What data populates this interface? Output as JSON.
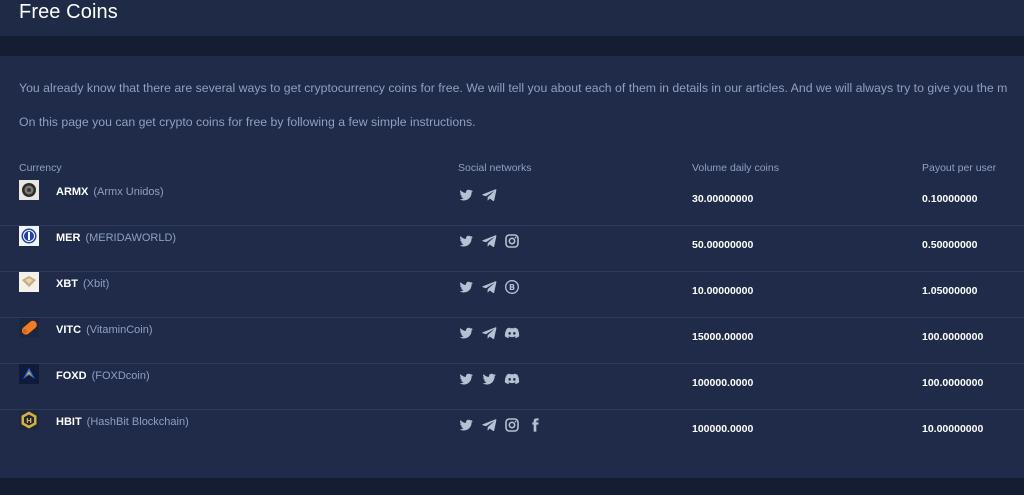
{
  "page": {
    "title": "Free Coins"
  },
  "intro": {
    "paragraph1": "You already know that there are several ways to get cryptocurrency coins for free. We will tell you about each of them in details in our articles. And we will always try to give you the m",
    "paragraph2": "On this page you can get crypto coins for free by following a few simple instructions."
  },
  "table": {
    "headers": {
      "currency": "Currency",
      "social": "Social networks",
      "volume": "Volume daily coins",
      "payout": "Payout per user"
    },
    "rows": [
      {
        "symbol": "ARMX",
        "name": "(Armx Unidos)",
        "logo": "armx-logo",
        "socials": [
          "twitter-icon",
          "telegram-icon"
        ],
        "volume": "30.00000000",
        "payout": "0.10000000"
      },
      {
        "symbol": "MER",
        "name": "(MERIDAWORLD)",
        "logo": "mer-logo",
        "socials": [
          "twitter-icon",
          "telegram-icon",
          "instagram-icon"
        ],
        "volume": "50.00000000",
        "payout": "0.50000000"
      },
      {
        "symbol": "XBT",
        "name": "(Xbit)",
        "logo": "xbt-logo",
        "socials": [
          "twitter-icon",
          "telegram-icon",
          "bitcointalk-icon"
        ],
        "volume": "10.00000000",
        "payout": "1.05000000"
      },
      {
        "symbol": "VITC",
        "name": "(VitaminCoin)",
        "logo": "vitc-logo",
        "socials": [
          "twitter-icon",
          "telegram-icon",
          "discord-icon"
        ],
        "volume": "15000.00000",
        "payout": "100.0000000"
      },
      {
        "symbol": "FOXD",
        "name": "(FOXDcoin)",
        "logo": "foxd-logo",
        "socials": [
          "twitter-icon",
          "twitter-icon",
          "discord-icon"
        ],
        "volume": "100000.0000",
        "payout": "100.0000000"
      },
      {
        "symbol": "HBIT",
        "name": "(HashBit Blockchain)",
        "logo": "hbit-logo",
        "socials": [
          "twitter-icon",
          "telegram-icon",
          "instagram-icon",
          "facebook-icon"
        ],
        "volume": "100000.0000",
        "payout": "10.00000000"
      }
    ]
  },
  "colors": {
    "background": "#1f2b48",
    "band": "#141d32",
    "muted_text": "#8fa0c4",
    "icon": "#b7c0d3"
  }
}
